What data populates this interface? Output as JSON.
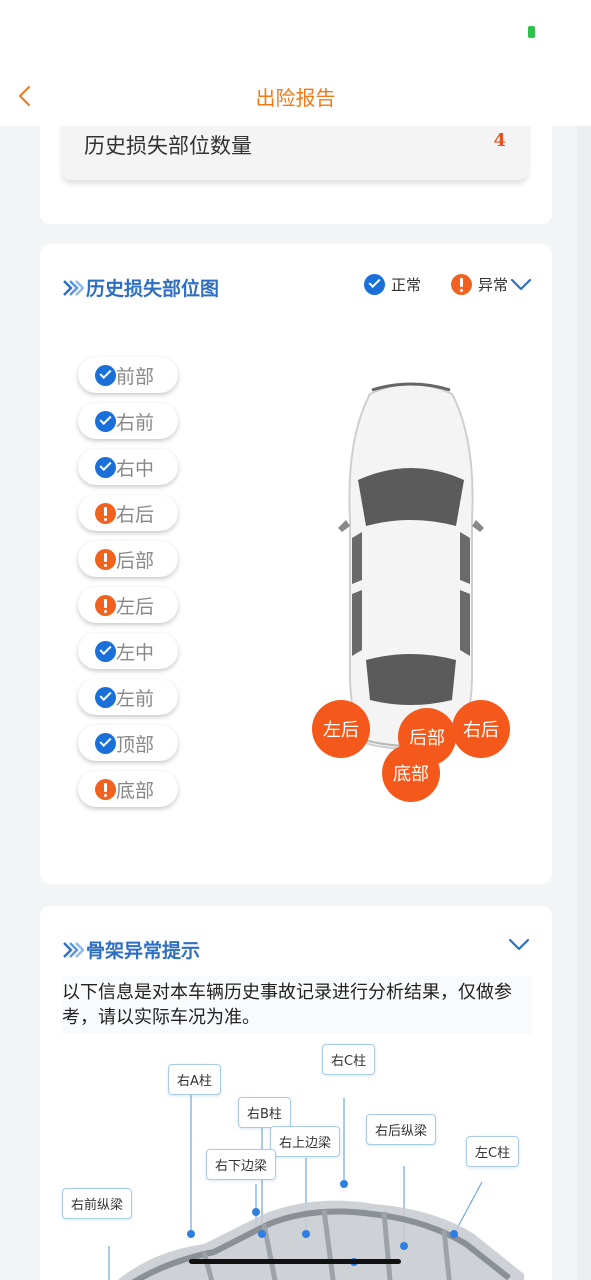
{
  "header": {
    "title": "出险报告"
  },
  "summary": {
    "label": "历史损失部位数量",
    "value": "4"
  },
  "damage_map": {
    "title": "历史损失部位图",
    "legend": {
      "normal": "正常",
      "abnormal": "异常"
    },
    "parts": [
      {
        "label": "前部",
        "status": "normal"
      },
      {
        "label": "右前",
        "status": "normal"
      },
      {
        "label": "右中",
        "status": "normal"
      },
      {
        "label": "右后",
        "status": "abnormal"
      },
      {
        "label": "后部",
        "status": "abnormal"
      },
      {
        "label": "左后",
        "status": "abnormal"
      },
      {
        "label": "左中",
        "status": "normal"
      },
      {
        "label": "左前",
        "status": "normal"
      },
      {
        "label": "顶部",
        "status": "normal"
      },
      {
        "label": "底部",
        "status": "abnormal"
      }
    ],
    "markers": [
      "左后",
      "后部",
      "右后",
      "底部"
    ]
  },
  "frame_section": {
    "title": "骨架异常提示",
    "note": "以下信息是对本车辆历史事故记录进行分析结果，仅做参考，请以实际车况为准。",
    "labels": [
      "右A柱",
      "右C柱",
      "右B柱",
      "右后纵梁",
      "右上边梁",
      "右下边梁",
      "左C柱",
      "右前纵梁"
    ]
  },
  "colors": {
    "accent": "#f07a1a",
    "brand_blue": "#2f6fc2",
    "ok": "#1a6fd8",
    "bad": "#f0621e",
    "marker": "#f4591b"
  },
  "icons": {
    "back": "chevron-left-icon",
    "ok": "check-circle-icon",
    "bad": "exclamation-circle-icon",
    "expand": "chevron-down-icon",
    "section": "double-chevron-right-icon"
  }
}
